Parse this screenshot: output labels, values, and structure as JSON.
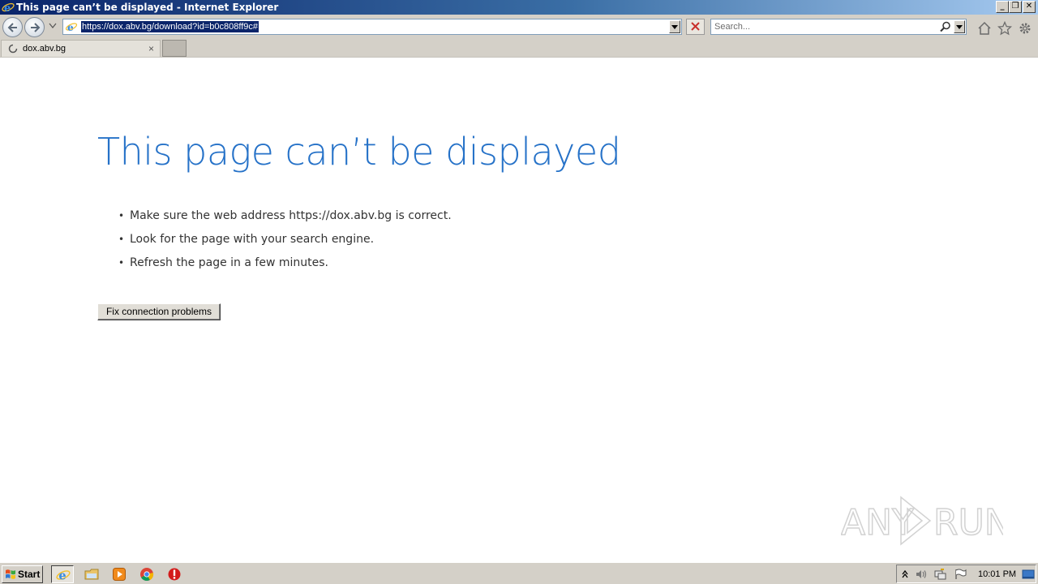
{
  "window": {
    "title": "This page can’t be displayed - Internet Explorer",
    "minimize_glyph": "_",
    "maximize_glyph": "❐",
    "close_glyph": "✕"
  },
  "navigation": {
    "address_url": "https://dox.abv.bg/download?id=b0c808ff9c#",
    "search_placeholder": "Search..."
  },
  "tabs": [
    {
      "label": "dox.abv.bg",
      "close_glyph": "×",
      "loading": true
    }
  ],
  "content": {
    "heading": "This page can’t be displayed",
    "tips": [
      "Make sure the web address https://dox.abv.bg is correct.",
      "Look for the page with your search engine.",
      "Refresh the page in a few minutes."
    ],
    "fix_button_label": "Fix connection problems",
    "heading_color": "#2672c8"
  },
  "watermark": {
    "text_left": "ANY",
    "text_right": "RUN"
  },
  "taskbar": {
    "start_label": "Start",
    "items": [
      "internet-explorer-icon",
      "file-explorer-icon",
      "media-player-icon",
      "chrome-icon",
      "antivirus-alert-icon"
    ],
    "clock": "10:01 PM"
  }
}
